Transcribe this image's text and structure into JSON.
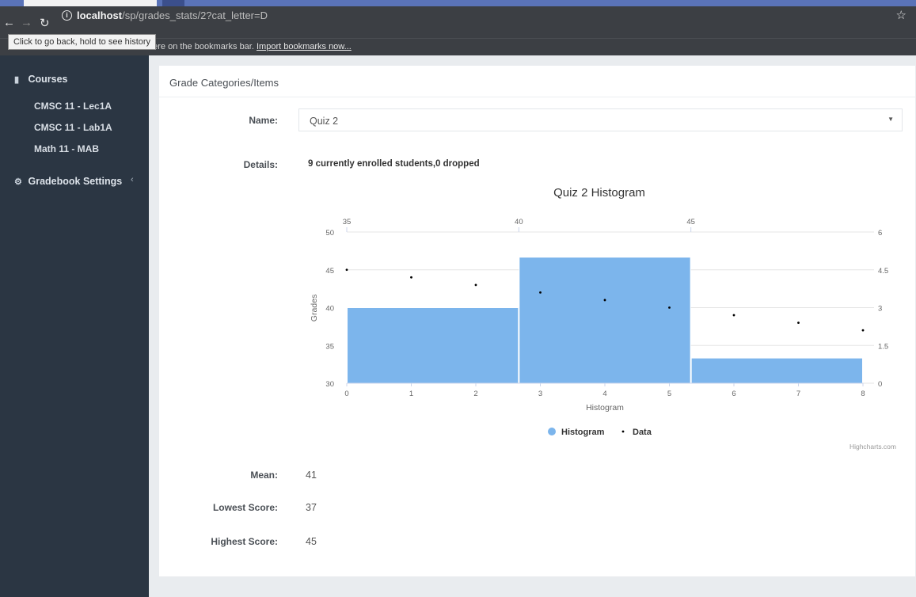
{
  "browser": {
    "url_host": "localhost",
    "url_path": "/sp/grades_stats/2?cat_letter=D",
    "tooltip": "Click to go back, hold to see history",
    "bookmarks_text": "here on the bookmarks bar.",
    "bookmarks_link": "Import bookmarks now..."
  },
  "sidebar": {
    "courses_label": "Courses",
    "items": [
      "CMSC 11 - Lec1A",
      "CMSC 11 - Lab1A",
      "Math 11 - MAB"
    ],
    "settings_label": "Gradebook Settings"
  },
  "panel": {
    "title": "Grade Categories/Items",
    "name_label": "Name:",
    "name_value": "Quiz 2",
    "details_label": "Details:",
    "details_value": "9 currently enrolled students,0 dropped",
    "mean_label": "Mean:",
    "mean_value": "41",
    "lowest_label": "Lowest Score:",
    "lowest_value": "37",
    "highest_label": "Highest Score:",
    "highest_value": "45"
  },
  "chart_data": {
    "type": "bar",
    "title": "Quiz 2 Histogram",
    "credits": "Highcharts.com",
    "xlabel": "Histogram",
    "ylabel": "Grades",
    "x_bottom_range": [
      0,
      8
    ],
    "x_bottom_ticks": [
      "0",
      "1",
      "2",
      "3",
      "4",
      "5",
      "6",
      "7",
      "8"
    ],
    "x_top_range": [
      35,
      50
    ],
    "x_top_ticks": [
      "35",
      "40",
      "45"
    ],
    "y_left_range": [
      30,
      50
    ],
    "y_left_ticks": [
      "30",
      "35",
      "40",
      "45",
      "50"
    ],
    "y_right_range": [
      0,
      6
    ],
    "y_right_ticks": [
      "0",
      "1.5",
      "3",
      "4.5",
      "6"
    ],
    "legend": [
      "Histogram",
      "Data"
    ],
    "legend_placement": "bottom-center",
    "grid": true,
    "colors": {
      "histogram": "#7cb5ec",
      "data": "#000000"
    },
    "series": [
      {
        "name": "Histogram",
        "type": "column",
        "bins": [
          {
            "from": 35,
            "to": 40,
            "count": 3
          },
          {
            "from": 40,
            "to": 45,
            "count": 5
          },
          {
            "from": 45,
            "to": 50,
            "count": 1
          }
        ]
      },
      {
        "name": "Data",
        "type": "scatter",
        "x": [
          0,
          1,
          2,
          3,
          4,
          5,
          6,
          7,
          8
        ],
        "values": [
          45,
          44,
          43,
          42,
          41,
          40,
          39,
          38,
          37
        ]
      }
    ]
  }
}
